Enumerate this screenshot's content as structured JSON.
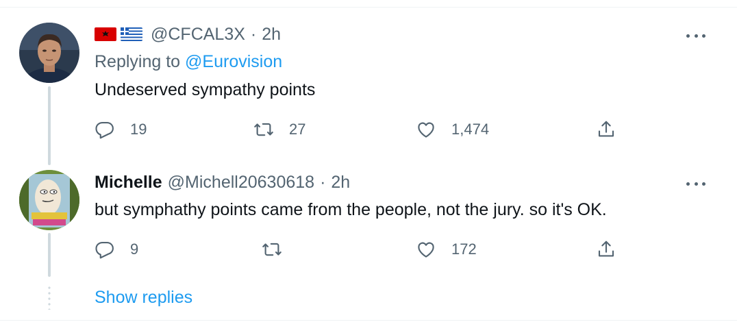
{
  "tweet1": {
    "flags": [
      "albania-flag",
      "greece-flag"
    ],
    "handle": "@CFCAL3X",
    "separator": "·",
    "time": "2h",
    "replying_label": "Replying to",
    "replying_to": "@Eurovision",
    "text": "Undeserved sympathy points",
    "actions": {
      "replies": "19",
      "retweets": "27",
      "likes": "1,474"
    }
  },
  "tweet2": {
    "name": "Michelle",
    "handle": "@Michell20630618",
    "separator": "·",
    "time": "2h",
    "text": "but symphathy points came from the people, not the jury. so it's OK.",
    "actions": {
      "replies": "9",
      "retweets": "",
      "likes": "172"
    }
  },
  "show_replies": "Show replies",
  "colors": {
    "link": "#1d9bf0",
    "muted": "#536471",
    "text": "#0f1419",
    "thread_line": "#cfd9de"
  },
  "icons": [
    "reply-icon",
    "retweet-icon",
    "like-icon",
    "share-icon",
    "more-icon"
  ]
}
